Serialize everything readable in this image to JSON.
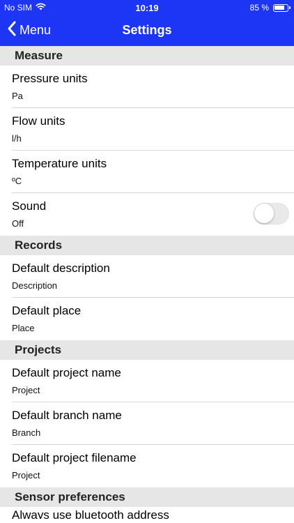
{
  "status_bar": {
    "carrier": "No SIM",
    "time": "10:19",
    "battery_text": "85 %",
    "battery_level": 0.85,
    "icons": [
      "wifi-icon",
      "battery-icon"
    ]
  },
  "nav": {
    "back_label": "Menu",
    "title": "Settings",
    "color": "#1d35f5"
  },
  "sections": {
    "measure": {
      "header": "Measure",
      "pressure": {
        "title": "Pressure units",
        "value": "Pa"
      },
      "flow": {
        "title": "Flow units",
        "value": "l/h"
      },
      "temperature": {
        "title": "Temperature units",
        "value": "ºC"
      },
      "sound": {
        "title": "Sound",
        "value": "Off",
        "enabled": false
      }
    },
    "records": {
      "header": "Records",
      "description": {
        "title": "Default description",
        "value": "Description"
      },
      "place": {
        "title": "Default place",
        "value": "Place"
      }
    },
    "projects": {
      "header": "Projects",
      "project_name": {
        "title": "Default project name",
        "value": "Project"
      },
      "branch_name": {
        "title": "Default branch name",
        "value": "Branch"
      },
      "project_filename": {
        "title": "Default project filename",
        "value": "Project"
      }
    },
    "sensor": {
      "header": "Sensor preferences",
      "bluetooth": {
        "title": "Always use bluetooth address"
      }
    }
  }
}
